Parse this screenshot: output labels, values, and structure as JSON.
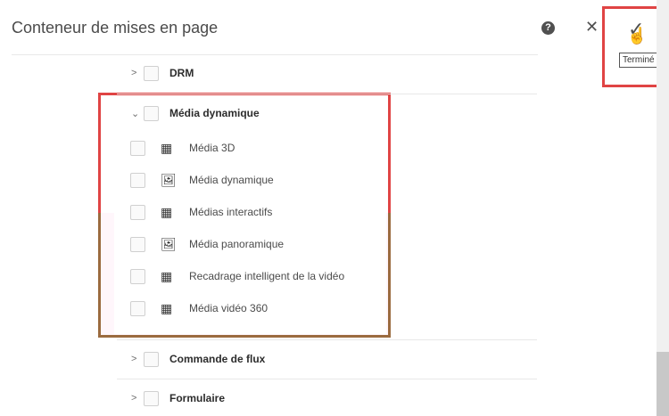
{
  "header": {
    "title": "Conteneur de mises en page",
    "help_icon": "?",
    "close_icon": "✕",
    "done_icon": "✓",
    "done_tooltip": "Terminé"
  },
  "groups": [
    {
      "label": "DRM",
      "expanded": false
    },
    {
      "label": "Média dynamique",
      "expanded": true,
      "items": [
        {
          "label": "Média 3D",
          "icon": "component-icon"
        },
        {
          "label": "Média dynamique",
          "icon": "image-icon"
        },
        {
          "label": "Médias interactifs",
          "icon": "component-icon"
        },
        {
          "label": "Média panoramique",
          "icon": "image-icon"
        },
        {
          "label": "Recadrage intelligent de la vidéo",
          "icon": "component-icon"
        },
        {
          "label": "Média vidéo 360",
          "icon": "component-icon"
        }
      ]
    },
    {
      "label": "Commande de flux",
      "expanded": false
    },
    {
      "label": "Formulaire",
      "expanded": false
    }
  ],
  "colors": {
    "highlight": "#e04444"
  }
}
